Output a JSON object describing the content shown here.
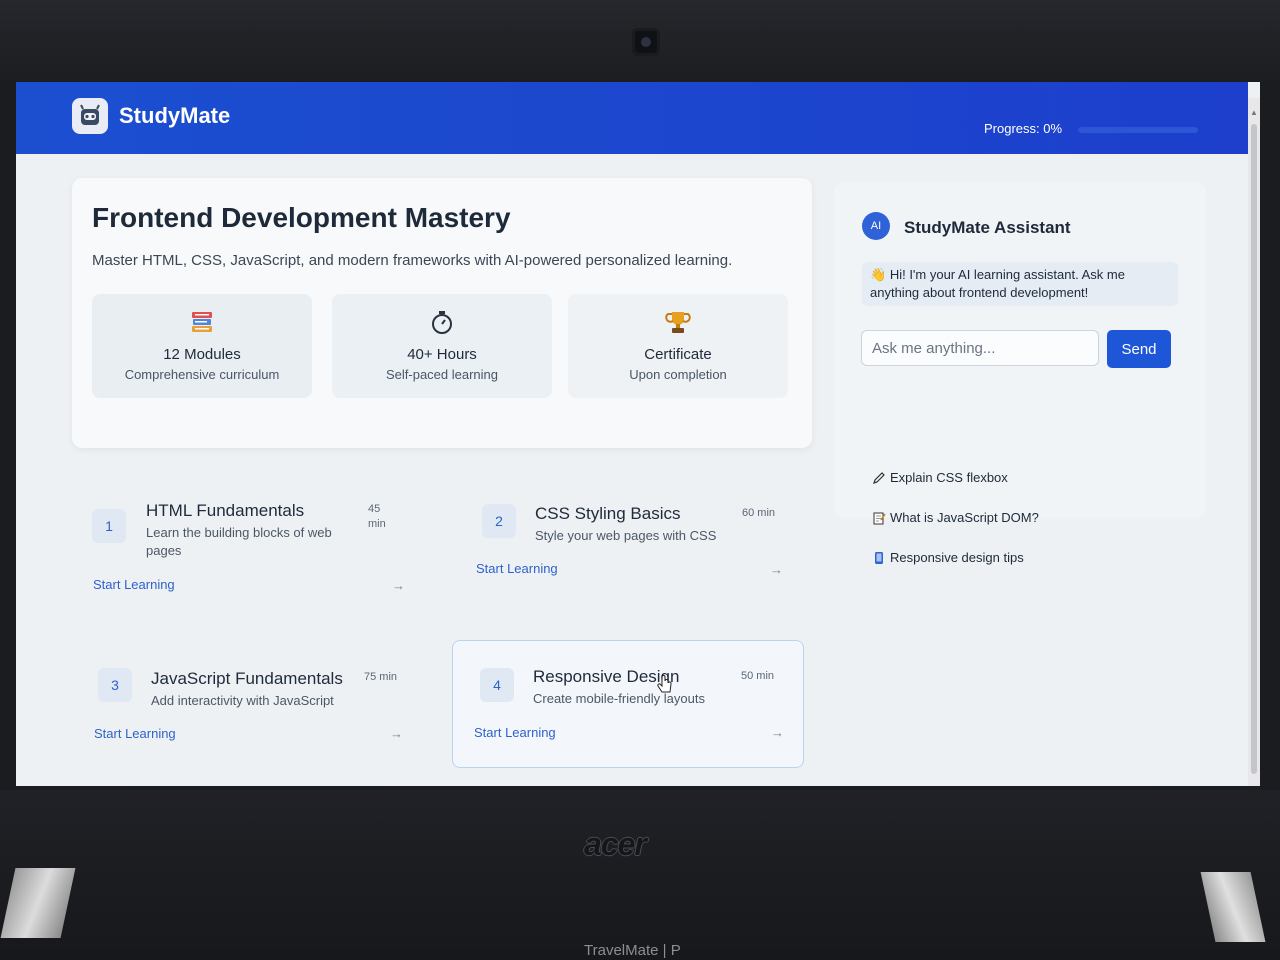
{
  "app": {
    "name": "StudyMate"
  },
  "header": {
    "progress_label": "Progress: 0%",
    "progress_value": 0
  },
  "hero": {
    "title": "Frontend Development Mastery",
    "subtitle": "Master HTML, CSS, JavaScript, and modern frameworks with AI-powered personalized learning.",
    "stats": [
      {
        "icon": "books-icon",
        "title": "12 Modules",
        "desc": "Comprehensive curriculum"
      },
      {
        "icon": "stopwatch-icon",
        "title": "40+ Hours",
        "desc": "Self-paced learning"
      },
      {
        "icon": "trophy-icon",
        "title": "Certificate",
        "desc": "Upon completion"
      }
    ]
  },
  "modules": [
    {
      "num": "1",
      "title": "HTML Fundamentals",
      "desc": "Learn the building blocks of web pages",
      "duration": "45 min",
      "cta": "Start Learning",
      "arrow": "→"
    },
    {
      "num": "2",
      "title": "CSS Styling Basics",
      "desc": "Style your web pages with CSS",
      "duration": "60 min",
      "cta": "Start Learning",
      "arrow": "→"
    },
    {
      "num": "3",
      "title": "JavaScript Fundamentals",
      "desc": "Add interactivity with JavaScript",
      "duration": "75 min",
      "cta": "Start Learning",
      "arrow": "→"
    },
    {
      "num": "4",
      "title": "Responsive Design",
      "desc": "Create mobile-friendly layouts",
      "duration": "50 min",
      "cta": "Start Learning",
      "arrow": "→"
    }
  ],
  "assistant": {
    "badge": "AI",
    "title": "StudyMate Assistant",
    "message": "Hi! I'm your AI learning assistant. Ask me anything about frontend development!",
    "input_placeholder": "Ask me anything...",
    "send_label": "Send",
    "suggestions": [
      {
        "icon": "pencil-icon",
        "label": "Explain CSS flexbox"
      },
      {
        "icon": "memo-icon",
        "label": "What is JavaScript DOM?"
      },
      {
        "icon": "mobile-phone-icon",
        "label": "Responsive design tips"
      }
    ]
  },
  "device": {
    "brand": "acer",
    "model": "TravelMate | P"
  }
}
